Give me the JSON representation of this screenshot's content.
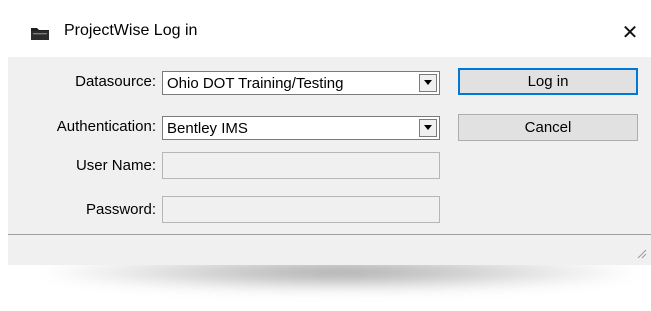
{
  "window": {
    "title": "ProjectWise Log in",
    "icon": "folder-icon",
    "close_glyph": "✕"
  },
  "form": {
    "datasource": {
      "label": "Datasource:",
      "value": "Ohio DOT Training/Testing"
    },
    "authentication": {
      "label": "Authentication:",
      "value": "Bentley IMS"
    },
    "username": {
      "label": "User Name:",
      "value": ""
    },
    "password": {
      "label": "Password:",
      "value": ""
    }
  },
  "buttons": {
    "login": "Log in",
    "cancel": "Cancel"
  },
  "colors": {
    "accent": "#0078d7",
    "dialog_bg": "#f0f0f0"
  }
}
